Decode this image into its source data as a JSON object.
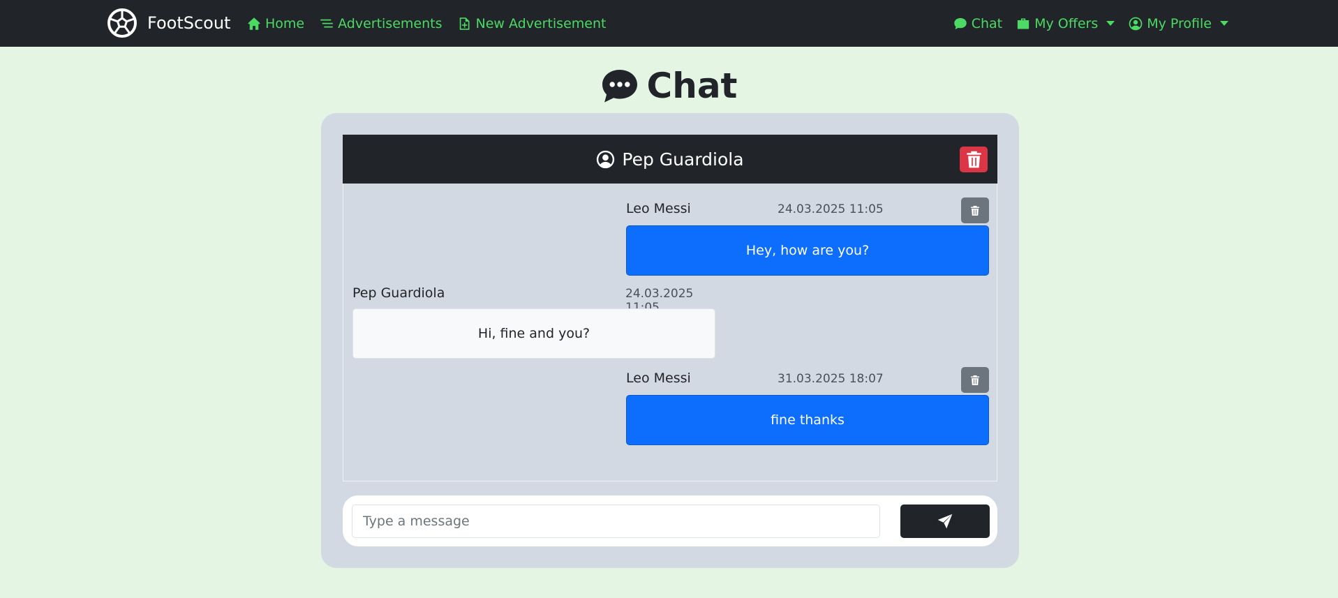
{
  "brand": {
    "name": "FootScout",
    "icon": "soccer-ball-icon"
  },
  "nav": {
    "left": [
      {
        "label": "Home",
        "icon": "house-icon"
      },
      {
        "label": "Advertisements",
        "icon": "list-icon"
      },
      {
        "label": "New Advertisement",
        "icon": "file-plus-icon"
      }
    ],
    "right": [
      {
        "label": "Chat",
        "icon": "chat-bubble-icon"
      },
      {
        "label": "My Offers",
        "icon": "briefcase-icon"
      },
      {
        "label": "My Profile",
        "icon": "person-circle-icon"
      }
    ]
  },
  "page": {
    "title": "Chat",
    "title_icon": "chat-dots-icon"
  },
  "chat": {
    "partner_name": "Pep Guardiola",
    "messages": [
      {
        "sender": "Leo Messi",
        "timestamp": "24.03.2025 11:05",
        "text": "Hey, how are you?",
        "own": true
      },
      {
        "sender": "Pep Guardiola",
        "timestamp": "24.03.2025 11:05",
        "text": "Hi, fine and you?",
        "own": false
      },
      {
        "sender": "Leo Messi",
        "timestamp": "31.03.2025 18:07",
        "text": "fine thanks",
        "own": true
      }
    ]
  },
  "composer": {
    "placeholder": "Type a message",
    "value": ""
  },
  "colors": {
    "background": "#e4f6e3",
    "navbar": "#212529",
    "nav_link": "#4cd964",
    "own_bubble": "#0d6efd",
    "danger": "#dc3545",
    "secondary": "#6c757d"
  }
}
